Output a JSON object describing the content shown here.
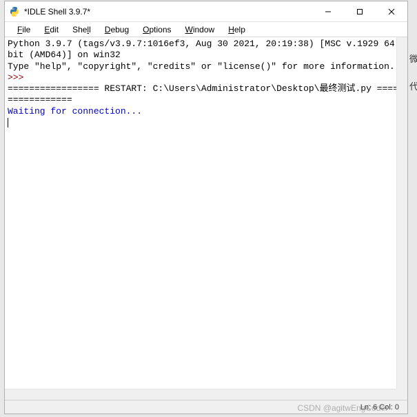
{
  "window": {
    "title": "*IDLE Shell 3.9.7*"
  },
  "menu": {
    "file": "File",
    "edit": "Edit",
    "shell": "Shell",
    "debug": "Debug",
    "options": "Options",
    "window": "Window",
    "help": "Help"
  },
  "content": {
    "banner_line1": "Python 3.9.7 (tags/v3.9.7:1016ef3, Aug 30 2021, 20:19:38) [MSC v.1929 64 bit (AMD64)] on win32",
    "banner_line2": "Type \"help\", \"copyright\", \"credits\" or \"license()\" for more information.",
    "prompt": ">>>",
    "restart_line": "================= RESTART: C:\\Users\\Administrator\\Desktop\\最终测试.py =================",
    "waiting": "Waiting for connection..."
  },
  "status": {
    "position": "Ln: 6  Col: 0"
  },
  "watermark": "CSDN @agitwEngCoder",
  "bg_chars": {
    "a": "微",
    "b": "代"
  }
}
